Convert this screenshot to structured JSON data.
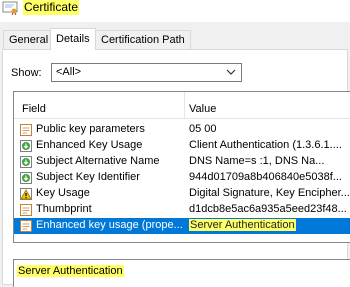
{
  "window": {
    "title": "Certificate"
  },
  "tabs": [
    {
      "label": "General"
    },
    {
      "label": "Details"
    },
    {
      "label": "Certification Path"
    }
  ],
  "show_filter": {
    "label": "Show:",
    "value": "<All>"
  },
  "list": {
    "columns": {
      "field": "Field",
      "value": "Value"
    },
    "rows": [
      {
        "field": "Public key parameters",
        "value": "05 00",
        "icon": "certificate-field-icon"
      },
      {
        "field": "Enhanced Key Usage",
        "value": "Client Authentication (1.3.6.1....",
        "icon": "extension-download-icon"
      },
      {
        "field": "Subject Alternative Name",
        "value": "DNS Name=s            :1, DNS Na...",
        "icon": "extension-download-icon"
      },
      {
        "field": "Subject Key Identifier",
        "value": "944d01709a8b406840e5038f...",
        "icon": "extension-download-icon"
      },
      {
        "field": "Key Usage",
        "value": "Digital Signature, Key Encipher...",
        "icon": "warning-icon"
      },
      {
        "field": "Thumbprint",
        "value": "d1dcb8e5ac6a935a5eed23f48...",
        "icon": "certificate-field-icon"
      },
      {
        "field": "Enhanced key usage (prope...",
        "value": "Server Authentication",
        "icon": "certificate-field-icon",
        "selected": true
      }
    ]
  },
  "detail": {
    "text": "Server Authentication"
  },
  "colors": {
    "highlight": "#ffff66",
    "selection": "#0078d7"
  }
}
